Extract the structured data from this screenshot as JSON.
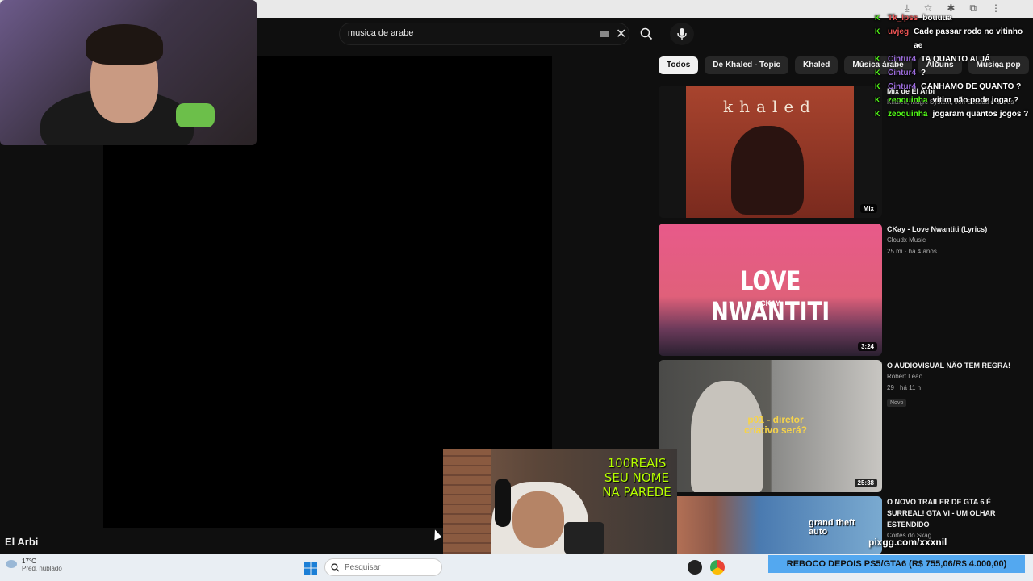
{
  "search": {
    "query": "musica de arabe"
  },
  "player": {
    "video_title": "El Arbi"
  },
  "chips": [
    "Todos",
    "De Khaled - Topic",
    "Khaled",
    "Música árabe",
    "Álbuns",
    "Música pop"
  ],
  "recommendations": [
    {
      "title": "Mix de El Arbi",
      "channel": "Khaled, Magic System, Jon Secada e outros",
      "stats": "",
      "badge": "Mix",
      "thumb_text": "khaled",
      "new": ""
    },
    {
      "title": "CKay - Love Nwantiti (Lyrics)",
      "channel": "Cloudx Music",
      "stats": "25 mi · há 4 anos",
      "badge": "3:24",
      "thumb_text": "LOVE NWANTITI",
      "thumb_sub": "CKAY",
      "new": ""
    },
    {
      "title": "O AUDIOVISUAL NÃO TEM REGRA!",
      "channel": "Robert Leão",
      "stats": "29 · há 11 h",
      "badge": "25:38",
      "thumb_text": "p01 - diretor criativo será?",
      "new": "Novo"
    },
    {
      "title": "O NOVO TRAILER DE GTA 6 É SURREAL! GTA VI - UM OLHAR ESTENDIDO",
      "channel": "Cortes do Skag",
      "stats": "",
      "badge": "",
      "thumb_text": "grand theft auto",
      "new": ""
    }
  ],
  "chat": [
    {
      "user": "Tk_lpss",
      "msg": "bouuua",
      "color": "red"
    },
    {
      "user": "uvjeg",
      "msg": "Cade passar rodo no vitinho ae",
      "color": "red"
    },
    {
      "user": "Cintur4",
      "msg": "TA QUANTO AI JÁ",
      "color": "purple"
    },
    {
      "user": "Cintur4",
      "msg": "?",
      "color": "purple"
    },
    {
      "user": "Cintur4",
      "msg": "GANHAMO DE QUANTO ?",
      "color": "purple"
    },
    {
      "user": "zeoquinha",
      "msg": "vitim não pode jogar ?",
      "color": "green"
    },
    {
      "user": "zeoquinha",
      "msg": "jogaram quantos jogos ?",
      "color": "green"
    }
  ],
  "overlay": {
    "cam_text": "100REAIS SEU NOME NA PAREDE",
    "pix": "pixgg.com/xxxnil",
    "banner": "REBOCO DEPOIS PS5/GTA6 (R$ 755,06/R$ 4.000,00)"
  },
  "taskbar": {
    "temp": "17°C",
    "weather": "Pred. nublado",
    "search_placeholder": "Pesquisar"
  }
}
